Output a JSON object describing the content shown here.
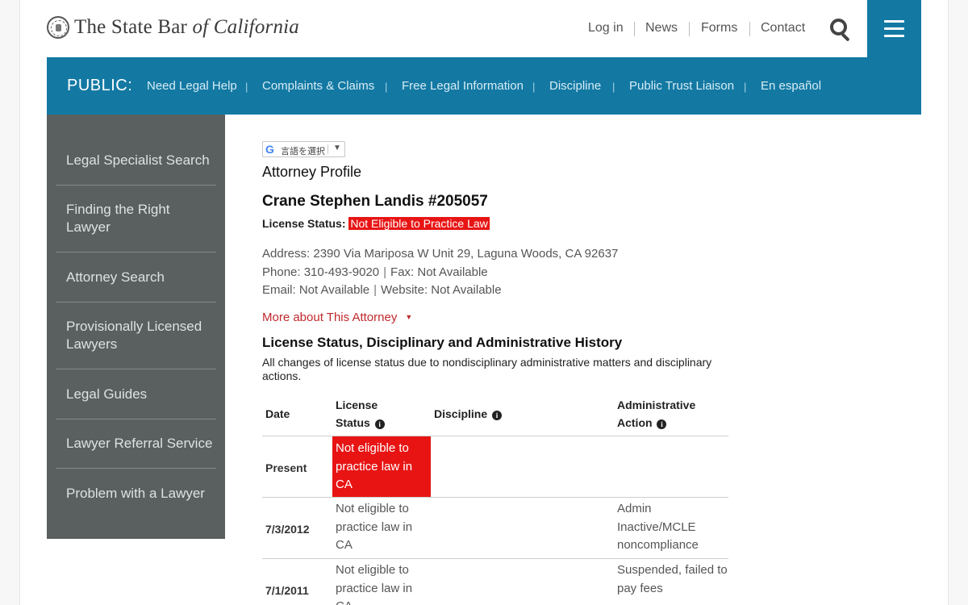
{
  "header": {
    "logo_main": "The State Bar",
    "logo_italic": "of California",
    "nav": [
      "Log in",
      "News",
      "Forms",
      "Contact"
    ]
  },
  "public_nav": {
    "label": "PUBLIC:",
    "items": [
      "Need Legal Help",
      "Complaints & Claims",
      "Free Legal Information",
      "Discipline",
      "Public Trust Liaison",
      "En español"
    ]
  },
  "sidebar": {
    "items": [
      "Legal Specialist Search",
      "Finding the Right Lawyer",
      "Attorney Search",
      "Provisionally Licensed Lawyers",
      "Legal Guides",
      "Lawyer Referral Service",
      "Problem with a Lawyer"
    ]
  },
  "translate": {
    "label": "言語を選択",
    "arrow": "▼"
  },
  "profile": {
    "heading": "Attorney Profile",
    "name": "Crane Stephen Landis #205057",
    "license_label": "License Status:",
    "license_value": "Not Eligible to Practice Law",
    "address": "Address: 2390 Via Mariposa W Unit 29, Laguna Woods, CA 92637",
    "phone": "Phone: 310-493-9020",
    "fax": "Fax: Not Available",
    "email": "Email: Not Available",
    "website": "Website: Not Available",
    "more_link": "More about This Attorney"
  },
  "history": {
    "heading": "License Status, Disciplinary and Administrative History",
    "description": "All changes of license status due to nondisciplinary administrative matters and disciplinary actions.",
    "columns": {
      "date": "Date",
      "license_1": "License",
      "license_2": "Status",
      "discipline": "Discipline",
      "admin_1": "Administrative",
      "admin_2": "Action"
    },
    "rows": [
      {
        "date": "Present",
        "status": "Not eligible to practice law in CA",
        "discipline": "",
        "action": ""
      },
      {
        "date": "7/3/2012",
        "status": "Not eligible to practice law in CA",
        "discipline": "",
        "action": "Admin Inactive/MCLE noncompliance"
      },
      {
        "date": "7/1/2011",
        "status": "Not eligible to practice law in CA",
        "discipline": "",
        "action": "Suspended, failed to pay fees"
      }
    ]
  }
}
